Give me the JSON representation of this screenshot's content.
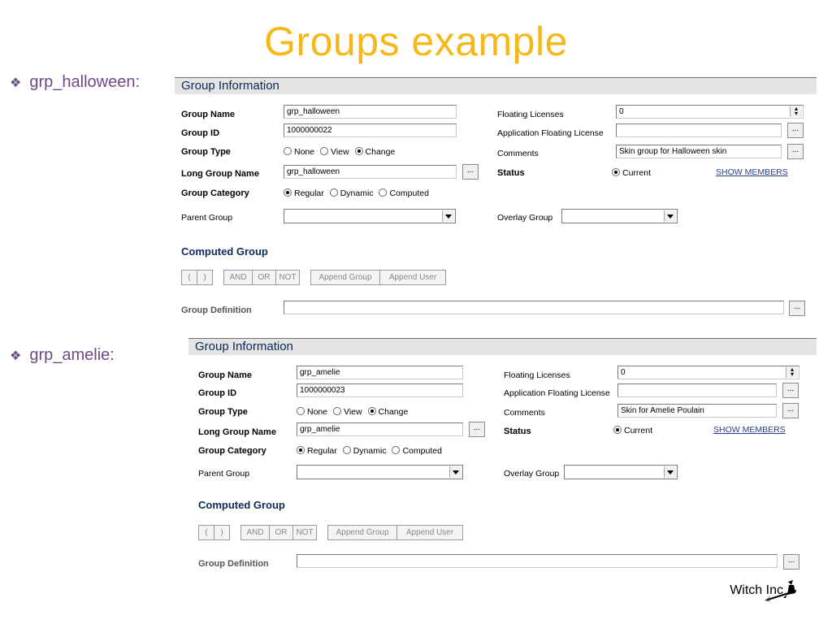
{
  "slide": {
    "title": "Groups example",
    "footer": "Witch Inc"
  },
  "bullets": [
    {
      "label": "grp_halloween:"
    },
    {
      "label": "grp_amelie:"
    }
  ],
  "labels": {
    "section_title": "Group Information",
    "group_name": "Group Name",
    "group_id": "Group ID",
    "group_type": "Group Type",
    "long_group_name": "Long Group Name",
    "group_category": "Group Category",
    "parent_group": "Parent Group",
    "floating_licenses": "Floating Licenses",
    "app_floating_license": "Application Floating License",
    "comments": "Comments",
    "status": "Status",
    "overlay_group": "Overlay Group",
    "show_members": "SHOW MEMBERS",
    "computed_group": "Computed Group",
    "group_definition": "Group Definition",
    "type_none": "None",
    "type_view": "View",
    "type_change": "Change",
    "cat_regular": "Regular",
    "cat_dynamic": "Dynamic",
    "cat_computed": "Computed",
    "status_current": "Current",
    "ellipsis": "...",
    "btn_open": "(",
    "btn_close": ")",
    "btn_and": "AND",
    "btn_or": "OR",
    "btn_not": "NOT",
    "btn_append_group": "Append Group",
    "btn_append_user": "Append User"
  },
  "groups": [
    {
      "group_name": "grp_halloween",
      "group_id": "1000000022",
      "long_group_name": "grp_halloween",
      "floating_licenses": "0",
      "comments": "Skin group for Halloween skin"
    },
    {
      "group_name": "grp_amelie",
      "group_id": "1000000023",
      "long_group_name": "grp_amelie",
      "floating_licenses": "0",
      "comments": "Skin for Amelie Poulain"
    }
  ]
}
